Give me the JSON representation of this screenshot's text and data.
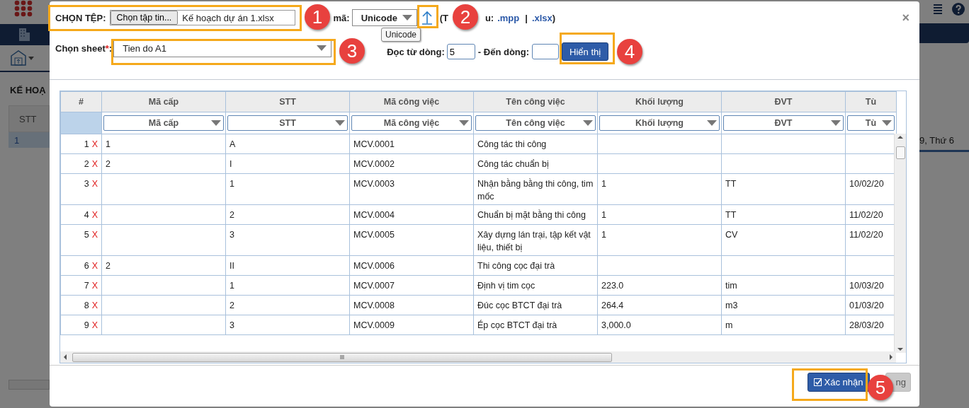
{
  "background": {
    "page_title": "KẾ HOẠ",
    "column_header": "STT",
    "row": {
      "cell": "1",
      "selected": true
    },
    "date_cell": "9, Thứ 6"
  },
  "dialog": {
    "file_label": "CHỌN TỆP:",
    "file_button": "Chọn tập tin...",
    "file_name": "Kế hoạch dự án 1.xlsx",
    "encoding_label": "mã:",
    "encoding_value": "Unicode",
    "encoding_tooltip": "Unicode",
    "format_start": "(T",
    "format_mid": "u:",
    "formats": [
      ".mpp",
      ".xlsx"
    ],
    "format_separator": "|",
    "format_end": ")",
    "close": "×",
    "sheet_label": "Chọn sheet",
    "required_mark": "*",
    "sheet_colon": ":",
    "sheet_value": "Tien do A1",
    "from_label": "Đọc từ dòng:",
    "from_value": "5",
    "to_label": "- Đến dòng:",
    "show_button": "Hiển thị",
    "table": {
      "index_header": "#",
      "columns": [
        "Mã cấp",
        "STT",
        "Mã công việc",
        "Tên công việc",
        "Khối lượng",
        "ĐVT",
        "Tù"
      ],
      "filters": [
        "Mã cấp",
        "STT",
        "Mã công việc",
        "Tên công việc",
        "Khối lượng",
        "ĐVT",
        "Tù"
      ],
      "rows": [
        {
          "index": "1",
          "delete": "X",
          "cells": [
            "1",
            "A",
            "MCV.0001",
            "Công tác thi công",
            null,
            null,
            null
          ]
        },
        {
          "index": "2",
          "delete": "X",
          "cells": [
            "2",
            "I",
            "MCV.0002",
            "Công tác chuẩn bị",
            null,
            null,
            null
          ]
        },
        {
          "index": "3",
          "delete": "X",
          "cells": [
            null,
            "1",
            "MCV.0003",
            "Nhận bằng bằng thi công, tim mốc",
            "1",
            "TT",
            "10/02/20"
          ]
        },
        {
          "index": "4",
          "delete": "X",
          "cells": [
            null,
            "2",
            "MCV.0004",
            "Chuẩn bị mặt bằng thi công",
            "1",
            "TT",
            "11/02/20"
          ]
        },
        {
          "index": "5",
          "delete": "X",
          "cells": [
            null,
            "3",
            "MCV.0005",
            "Xây dựng lán trại, tập kết vật liệu, thiết bị",
            "1",
            "CV",
            "11/02/20"
          ]
        },
        {
          "index": "6",
          "delete": "X",
          "cells": [
            "2",
            "II",
            "MCV.0006",
            "Thi công cọc đại trà",
            null,
            null,
            null
          ]
        },
        {
          "index": "7",
          "delete": "X",
          "cells": [
            null,
            "1",
            "MCV.0007",
            "Định vị tim cọc",
            "223.0",
            "tim",
            "10/03/20"
          ]
        },
        {
          "index": "8",
          "delete": "X",
          "cells": [
            null,
            "2",
            "MCV.0008",
            "Đúc cọc BTCT đại trà",
            "264.4",
            "m3",
            "01/03/20"
          ]
        },
        {
          "index": "9",
          "delete": "X",
          "cells": [
            null,
            "3",
            "MCV.0009",
            "Ép cọc BTCT đại trà",
            "3,000.0",
            "m",
            "28/03/20"
          ]
        }
      ]
    },
    "confirm_button": "Xác nhận",
    "close_button": "ng"
  },
  "callouts": [
    "1",
    "2",
    "3",
    "4",
    "5"
  ]
}
